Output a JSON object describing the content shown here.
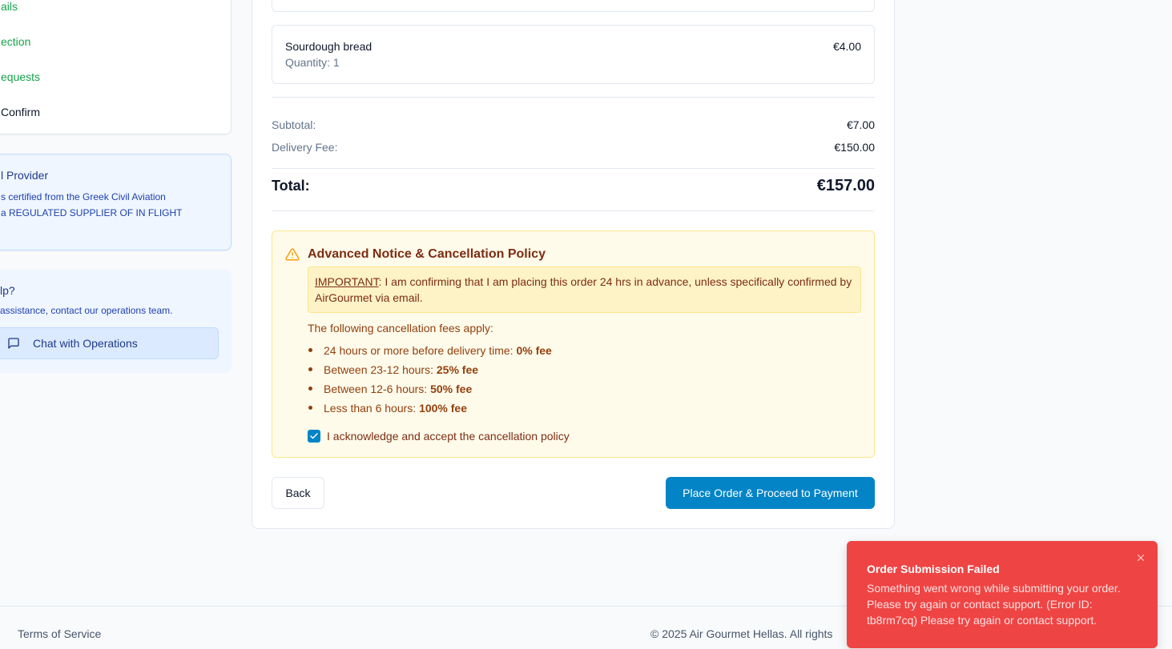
{
  "sidebar": {
    "steps": [
      {
        "label": "ails",
        "state": "done"
      },
      {
        "label": "ection",
        "state": "done"
      },
      {
        "label": "equests",
        "state": "done"
      },
      {
        "label": "Confirm",
        "state": "current"
      }
    ],
    "provider": {
      "title": "l Provider",
      "lines": [
        "s certified from the Greek Civil Aviation",
        "a REGULATED SUPPLIER OF IN FLIGHT"
      ]
    },
    "help": {
      "title": "lp?",
      "text": "assistance, contact our operations team.",
      "chat_button": "Chat with Operations",
      "chat_icon": "message-square-icon"
    }
  },
  "order": {
    "items": [
      {
        "name": "Sourdough bread",
        "quantity": "Quantity: 1",
        "price": "€4.00"
      }
    ],
    "subtotal_label": "Subtotal:",
    "subtotal_value": "€7.00",
    "delivery_label": "Delivery Fee:",
    "delivery_value": "€150.00",
    "total_label": "Total:",
    "total_value": "€157.00"
  },
  "policy": {
    "icon": "alert-triangle-icon",
    "title": "Advanced Notice & Cancellation Policy",
    "important_label": "IMPORTANT",
    "important_text": ": I am confirming that I am placing this order 24 hrs in advance, unless specifically confirmed by AirGourmet via email.",
    "fees_intro": "The following cancellation fees apply:",
    "fees": [
      {
        "text": "24 hours or more before delivery time: ",
        "fee": "0% fee"
      },
      {
        "text": "Between 23-12 hours: ",
        "fee": "25% fee"
      },
      {
        "text": "Between 12-6 hours: ",
        "fee": "50% fee"
      },
      {
        "text": "Less than 6 hours: ",
        "fee": "100% fee"
      }
    ],
    "acknowledge_label": "I acknowledge and accept the cancellation policy",
    "acknowledged": true
  },
  "actions": {
    "back": "Back",
    "place_order": "Place Order & Proceed to Payment"
  },
  "footer": {
    "terms": "Terms of Service",
    "copyright": "© 2025 Air Gourmet Hellas. All rights"
  },
  "toast": {
    "title": "Order Submission Failed",
    "message": "Something went wrong while submitting your order. Please try again or contact support. (Error ID: tb8rm7cq) Please try again or contact support."
  },
  "colors": {
    "primary": "#0284c7",
    "success": "#16a34a",
    "warning_bg": "#fffbeb",
    "error": "#ef4444"
  }
}
